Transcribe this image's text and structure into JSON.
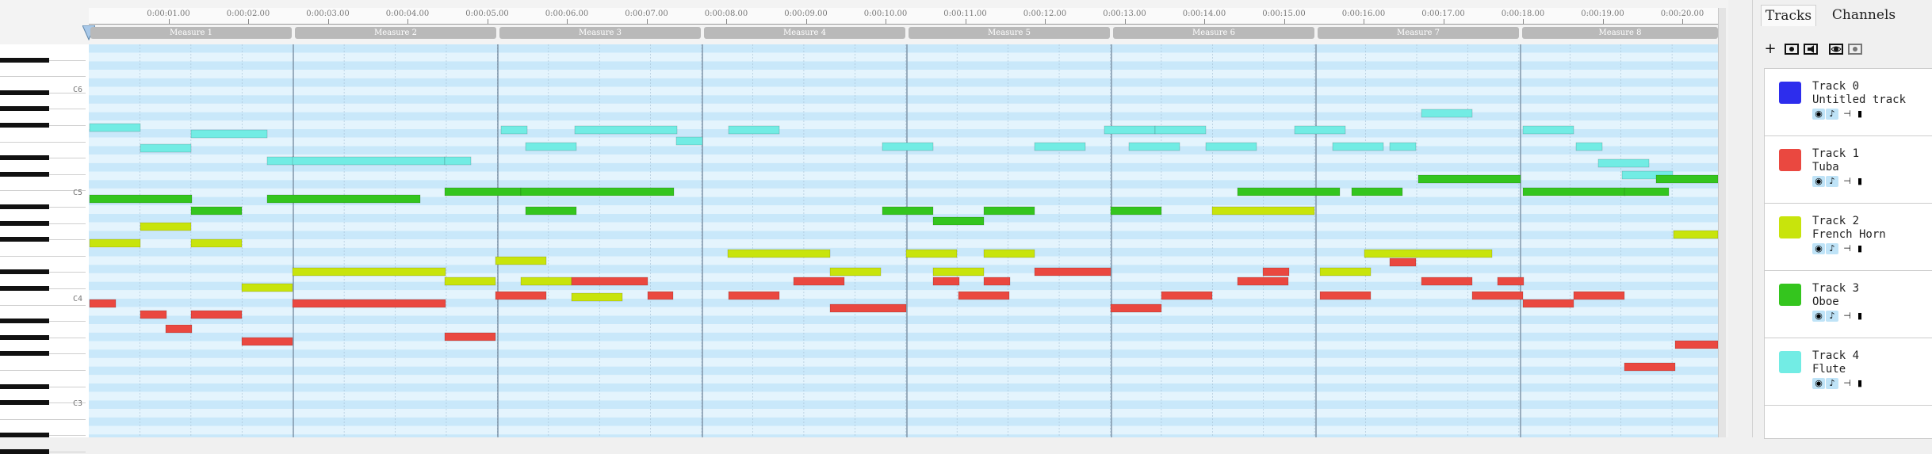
{
  "timeline": {
    "ticks": [
      "0:00:01.00",
      "0:00:02.00",
      "0:00:03.00",
      "0:00:04.00",
      "0:00:05.00",
      "0:00:06.00",
      "0:00:07.00",
      "0:00:08.00",
      "0:00:09.00",
      "0:00:10.00",
      "0:00:11.00",
      "0:00:12.00",
      "0:00:13.00",
      "0:00:14.00",
      "0:00:15.00",
      "0:00:16.00",
      "0:00:17.00",
      "0:00:18.00",
      "0:00:19.00",
      "0:00:20.00"
    ],
    "measures": [
      "Measure 1",
      "Measure 2",
      "Measure 3",
      "Measure 4",
      "Measure 5",
      "Measure 6",
      "Measure 7",
      "Measure 8"
    ]
  },
  "piano": {
    "octave_labels": [
      "C6",
      "C5",
      "C4",
      "C3"
    ]
  },
  "tabs": {
    "tracks": "Tracks",
    "channels": "Channels"
  },
  "toolbar": {
    "icons": [
      "add-track-icon",
      "record-icon",
      "mute-all-icon",
      "show-all-icon",
      "hide-all-icon"
    ]
  },
  "tracks": [
    {
      "number": "Track 0",
      "name": "Untitled track",
      "color": "#2d2ded"
    },
    {
      "number": "Track 1",
      "name": "Tuba",
      "color": "#ea4840"
    },
    {
      "number": "Track 2",
      "name": "French Horn",
      "color": "#c8e40c"
    },
    {
      "number": "Track 3",
      "name": "Oboe",
      "color": "#34c51e"
    },
    {
      "number": "Track 4",
      "name": "Flute",
      "color": "#72ece4"
    }
  ],
  "notes": {
    "flute": [
      [
        1,
        156,
        64
      ],
      [
        65,
        182,
        64
      ],
      [
        129,
        164,
        96
      ],
      [
        225,
        198,
        33
      ],
      [
        257,
        198,
        192
      ],
      [
        449,
        198,
        33
      ],
      [
        520,
        159,
        33
      ],
      [
        551,
        180,
        64
      ],
      [
        613,
        159,
        129
      ],
      [
        741,
        173,
        33
      ],
      [
        807,
        159,
        64
      ],
      [
        1001,
        180,
        64
      ],
      [
        1193,
        180,
        64
      ],
      [
        1281,
        159,
        64
      ],
      [
        1312,
        180,
        64
      ],
      [
        1345,
        159,
        64
      ],
      [
        1409,
        180,
        64
      ],
      [
        1521,
        159,
        64
      ],
      [
        1569,
        180,
        64
      ],
      [
        1641,
        180,
        33
      ],
      [
        1681,
        138,
        64
      ],
      [
        1809,
        159,
        64
      ],
      [
        1876,
        180,
        33
      ],
      [
        1904,
        201,
        64
      ],
      [
        1934,
        216,
        64
      ]
    ],
    "oboe": [
      [
        1,
        246,
        129
      ],
      [
        129,
        261,
        64
      ],
      [
        225,
        246,
        193
      ],
      [
        449,
        237,
        96
      ],
      [
        545,
        237,
        193
      ],
      [
        551,
        261,
        64
      ],
      [
        1001,
        261,
        64
      ],
      [
        1065,
        274,
        64
      ],
      [
        1129,
        261,
        64
      ],
      [
        1289,
        261,
        64
      ],
      [
        1449,
        237,
        129
      ],
      [
        1593,
        237,
        64
      ],
      [
        1677,
        221,
        129
      ],
      [
        1809,
        237,
        129
      ],
      [
        1937,
        237,
        56
      ],
      [
        1977,
        221,
        78
      ]
    ],
    "horn": [
      [
        1,
        302,
        64
      ],
      [
        65,
        281,
        64
      ],
      [
        129,
        302,
        64
      ],
      [
        193,
        358,
        64
      ],
      [
        257,
        338,
        193
      ],
      [
        449,
        350,
        64
      ],
      [
        513,
        324,
        64
      ],
      [
        545,
        350,
        64
      ],
      [
        609,
        370,
        64
      ],
      [
        806,
        315,
        129
      ],
      [
        935,
        338,
        64
      ],
      [
        1031,
        315,
        64
      ],
      [
        1065,
        338,
        64
      ],
      [
        1129,
        315,
        64
      ],
      [
        1417,
        261,
        129
      ],
      [
        1553,
        338,
        64
      ],
      [
        1609,
        315,
        161
      ],
      [
        1999,
        291,
        56
      ]
    ],
    "tuba": [
      [
        1,
        378,
        33
      ],
      [
        65,
        392,
        33
      ],
      [
        97,
        410,
        33
      ],
      [
        129,
        392,
        64
      ],
      [
        193,
        426,
        64
      ],
      [
        257,
        378,
        193
      ],
      [
        449,
        420,
        64
      ],
      [
        513,
        368,
        64
      ],
      [
        609,
        350,
        96
      ],
      [
        705,
        368,
        32
      ],
      [
        807,
        368,
        64
      ],
      [
        889,
        350,
        64
      ],
      [
        935,
        384,
        96
      ],
      [
        1065,
        350,
        33
      ],
      [
        1097,
        368,
        64
      ],
      [
        1129,
        350,
        33
      ],
      [
        1193,
        338,
        96
      ],
      [
        1289,
        384,
        64
      ],
      [
        1353,
        368,
        64
      ],
      [
        1449,
        350,
        64
      ],
      [
        1481,
        338,
        33
      ],
      [
        1553,
        368,
        64
      ],
      [
        1641,
        326,
        33
      ],
      [
        1681,
        350,
        64
      ],
      [
        1745,
        368,
        64
      ],
      [
        1777,
        350,
        33
      ],
      [
        1809,
        378,
        64
      ],
      [
        1873,
        368,
        64
      ],
      [
        1937,
        458,
        64
      ],
      [
        2001,
        430,
        54
      ]
    ]
  }
}
